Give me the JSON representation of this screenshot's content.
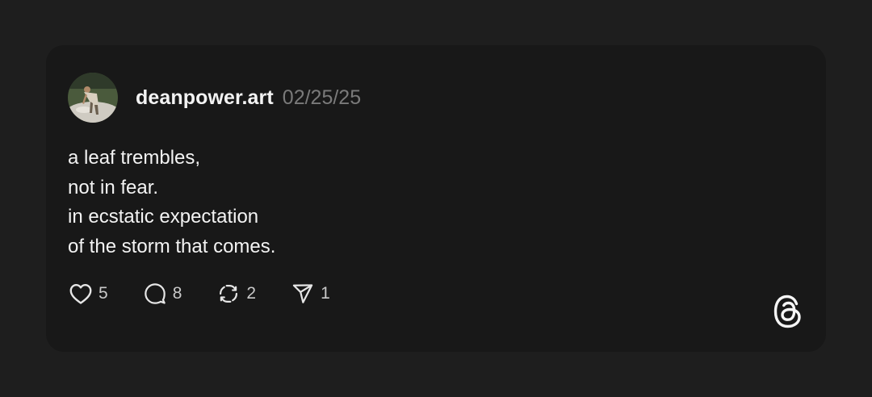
{
  "post": {
    "username": "deanpower.art",
    "date": "02/25/25",
    "lines": [
      "a leaf trembles,",
      "not in fear.",
      "in ecstatic expectation",
      "of the storm that comes."
    ]
  },
  "actions": {
    "likes": "5",
    "replies": "8",
    "reposts": "2",
    "shares": "1"
  },
  "icons": {
    "like": "heart-icon",
    "reply": "comment-icon",
    "repost": "repost-icon",
    "share": "send-icon",
    "brand": "threads-logo-icon"
  },
  "colors": {
    "page_background": "#1e1e1e",
    "card_background": "#181818",
    "text_primary": "#f3f3f3",
    "text_muted": "#7a7a7a"
  }
}
